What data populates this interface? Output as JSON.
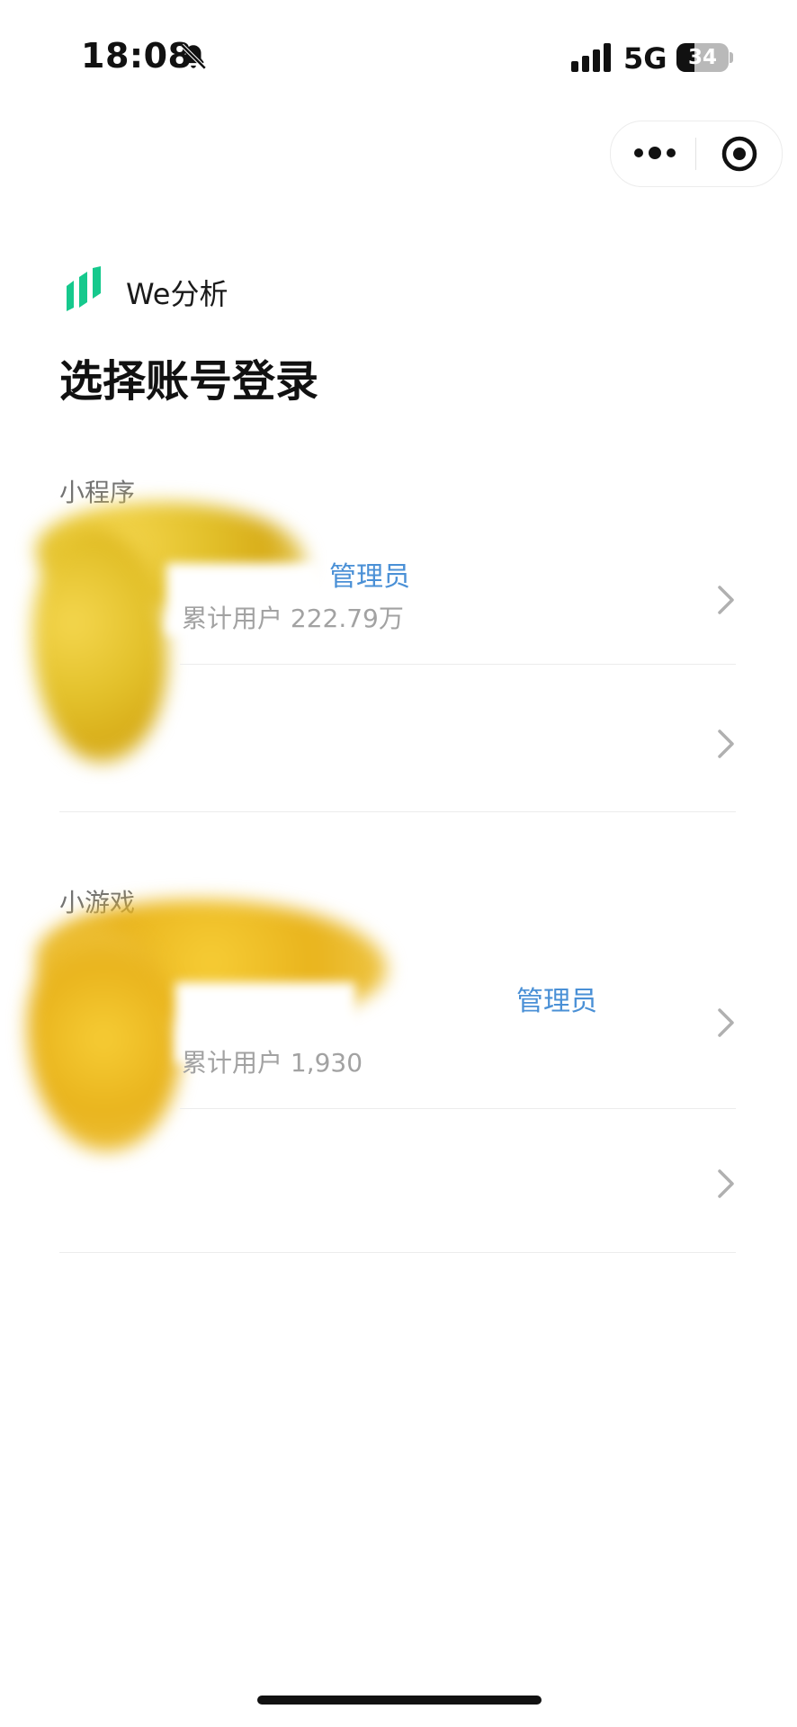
{
  "status_bar": {
    "time": "18:08",
    "network": "5G",
    "battery": "34",
    "battery_level": 0.34
  },
  "header": {
    "app_name": "We分析",
    "title": "选择账号登录"
  },
  "sections": [
    {
      "label": "小程序",
      "items": [
        {
          "role": "管理员",
          "stat": "累计用户 222.79万"
        },
        {
          "role": "",
          "stat": ""
        }
      ]
    },
    {
      "label": "小游戏",
      "items": [
        {
          "role": "管理员",
          "stat": "累计用户 1,930"
        },
        {
          "role": "",
          "stat": ""
        }
      ]
    }
  ],
  "colors": {
    "accent_blue": "#4a90d6",
    "logo_green": "#16c98d",
    "muted_text": "#a2a2a2"
  },
  "icons": {
    "bell": "bell-muted-icon",
    "signal": "cellular-signal-icon",
    "more": "more-dots-icon",
    "close": "target-close-icon",
    "chevron": "chevron-right-icon",
    "logo": "we-analysis-logo-icon"
  }
}
